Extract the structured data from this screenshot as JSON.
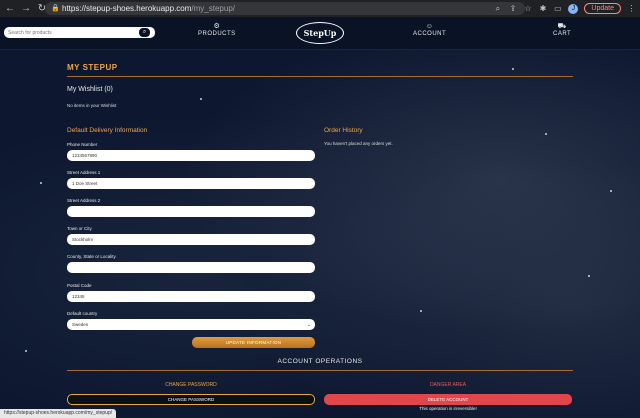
{
  "browser": {
    "url_host": "https://stepup-shoes.herokuapp.com",
    "url_path": "/my_stepup/",
    "update_label": "Update",
    "profile_initial": "J"
  },
  "nav": {
    "search_placeholder": "Search for products",
    "products_label": "PRODUCTS",
    "logo_text": "StepUp",
    "account_label": "ACCOUNT",
    "cart_label": "CART"
  },
  "page": {
    "title": "MY STEPUP",
    "wishlist_title": "My Wishlist (0)",
    "wishlist_empty": "No items in your Wishlist"
  },
  "delivery": {
    "heading": "Default Delivery Information",
    "fields": [
      {
        "label": "Phone Number",
        "value": "1234567890",
        "placeholder": ""
      },
      {
        "label": "Street Address 1",
        "value": "1 Doe Street",
        "placeholder": ""
      },
      {
        "label": "Street Address 2",
        "value": "",
        "placeholder": ""
      },
      {
        "label": "Town or City",
        "value": "Stockholm",
        "placeholder": ""
      },
      {
        "label": "County, State or Locality",
        "value": "",
        "placeholder": ""
      },
      {
        "label": "Postal Code",
        "value": "12345",
        "placeholder": ""
      }
    ],
    "country_label": "Default country",
    "country_value": "Sweden",
    "update_button": "UPDATE INFORMATION"
  },
  "orders": {
    "heading": "Order History",
    "empty": "You haven't placed any orders yet."
  },
  "account_ops": {
    "heading": "ACCOUNT OPERATIONS",
    "change_password_heading": "CHANGE PASSWORD",
    "change_password_button": "CHANGE PASSWORD",
    "danger_heading": "DANGER AREA",
    "delete_button": "DELETE ACCOUNT",
    "irreversible_note": "This operation is irreversible!"
  },
  "status_bar": "https://stepup-shoes.herokuapp.com/my_stepup/",
  "colors": {
    "accent": "#f0a545",
    "danger": "#e0464c",
    "nav_bg": "#0a1326"
  }
}
